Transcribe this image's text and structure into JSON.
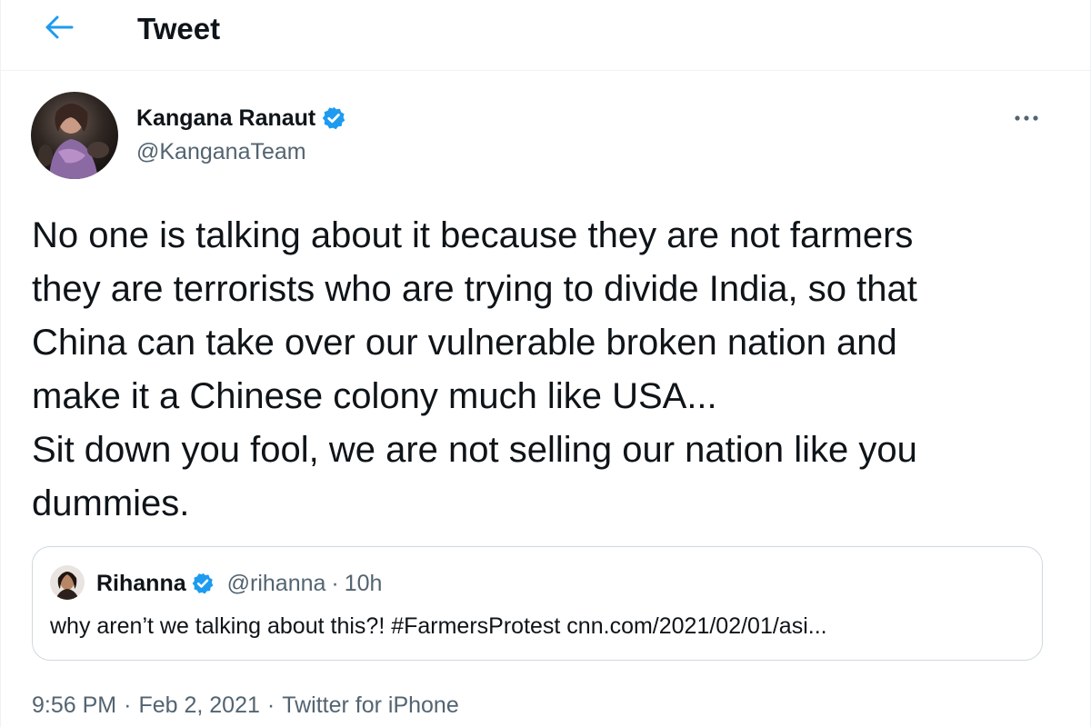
{
  "header": {
    "title": "Tweet",
    "back_icon": "arrow-left-icon"
  },
  "tweet": {
    "author": {
      "name": "Kangana Ranaut",
      "handle": "@KanganaTeam",
      "verified": true
    },
    "text": "No one is talking about it because they are not farmers\nthey are terrorists who are trying to divide India, so that\nChina can take over our vulnerable broken nation and\nmake it a Chinese colony much like USA...\nSit down you fool, we are not selling our nation like you\ndummies.",
    "more_icon": "more-horizontal-icon",
    "quoted": {
      "name": "Rihanna",
      "handle": "@rihanna",
      "separator": "·",
      "time": "10h",
      "verified": true,
      "text": "why aren’t we talking about this?! #FarmersProtest cnn.com/2021/02/01/asi..."
    },
    "meta": {
      "time": "9:56 PM",
      "separator": "·",
      "date": "Feb 2, 2021",
      "source": "Twitter for iPhone"
    }
  },
  "colors": {
    "accent": "#1d9bf0",
    "text_primary": "#0f1419",
    "text_secondary": "#536471",
    "border": "#cfd9de"
  }
}
